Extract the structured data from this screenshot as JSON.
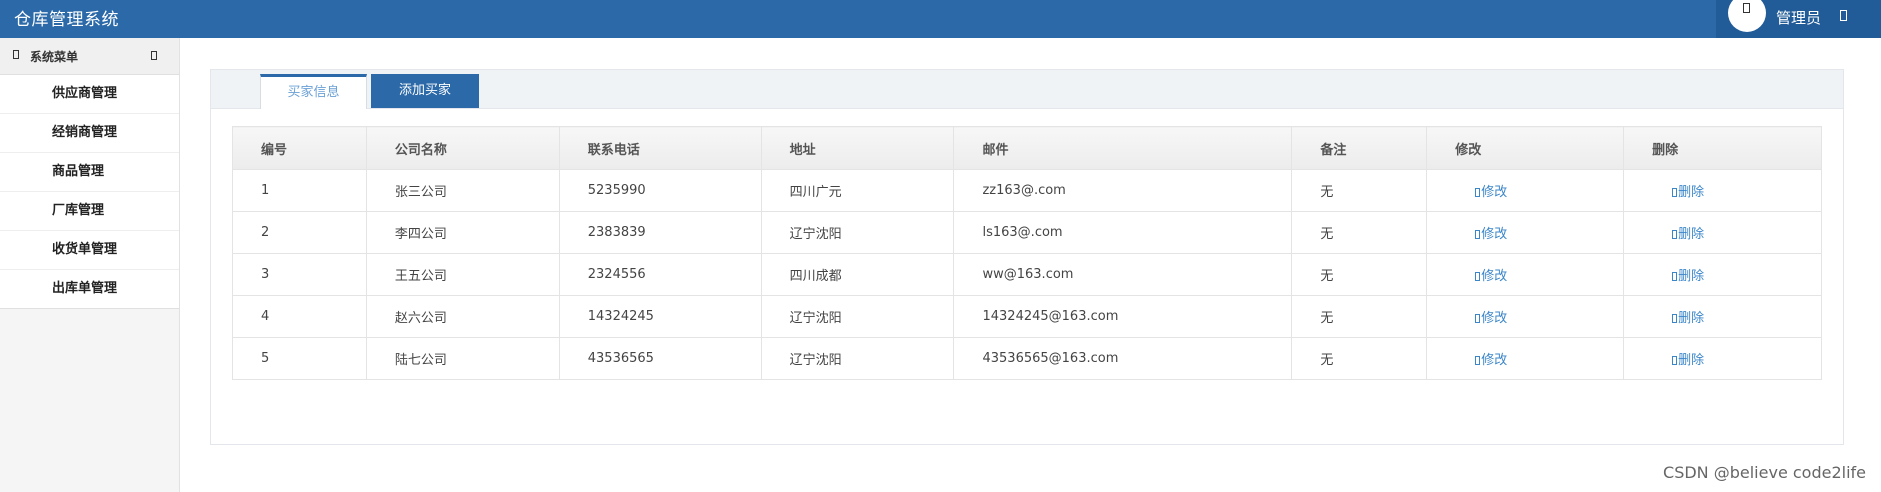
{
  "app": {
    "title": "仓库管理系统"
  },
  "user": {
    "name": "管理员"
  },
  "sidebar": {
    "header": "系统菜单",
    "items": [
      {
        "label": "供应商管理"
      },
      {
        "label": "经销商管理"
      },
      {
        "label": "商品管理"
      },
      {
        "label": "厂库管理"
      },
      {
        "label": "收货单管理"
      },
      {
        "label": "出库单管理"
      }
    ]
  },
  "tabs": [
    {
      "label": "买家信息",
      "active": true
    },
    {
      "label": "添加买家",
      "active": false
    }
  ],
  "table": {
    "columns": [
      "编号",
      "公司名称",
      "联系电话",
      "地址",
      "邮件",
      "备注",
      "修改",
      "删除"
    ],
    "rows": [
      {
        "id": "1",
        "company": "张三公司",
        "phone": "5235990",
        "address": "四川广元",
        "email": "zz163@.com",
        "note": "无",
        "edit": "修改",
        "delete": "删除"
      },
      {
        "id": "2",
        "company": "李四公司",
        "phone": "2383839",
        "address": "辽宁沈阳",
        "email": "ls163@.com",
        "note": "无",
        "edit": "修改",
        "delete": "删除"
      },
      {
        "id": "3",
        "company": "王五公司",
        "phone": "2324556",
        "address": "四川成都",
        "email": "ww@163.com",
        "note": "无",
        "edit": "修改",
        "delete": "删除"
      },
      {
        "id": "4",
        "company": "赵六公司",
        "phone": "14324245",
        "address": "辽宁沈阳",
        "email": "14324245@163.com",
        "note": "无",
        "edit": "修改",
        "delete": "删除"
      },
      {
        "id": "5",
        "company": "陆七公司",
        "phone": "43536565",
        "address": "辽宁沈阳",
        "email": "43536565@163.com",
        "note": "无",
        "edit": "修改",
        "delete": "删除"
      }
    ]
  },
  "watermark": "CSDN @believe code2life",
  "colors": {
    "header_bg": "#2b69a8",
    "link": "#3b86c9"
  }
}
